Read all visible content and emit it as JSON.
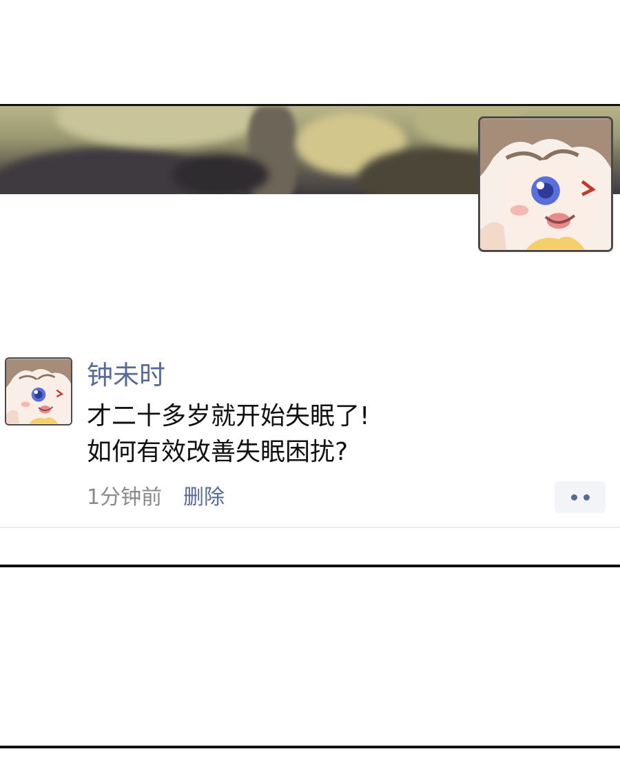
{
  "post": {
    "username": "钟未时",
    "text_lines": [
      "才二十多岁就开始失眠了!",
      "如何有效改善失眠困扰?"
    ],
    "time": "1分钟前",
    "delete_label": "删除",
    "more_icon": "more-dots-icon"
  },
  "colors": {
    "link": "#576b95",
    "text": "#111111",
    "meta": "#8a8a8a",
    "more_bg": "#f3f4f7"
  }
}
